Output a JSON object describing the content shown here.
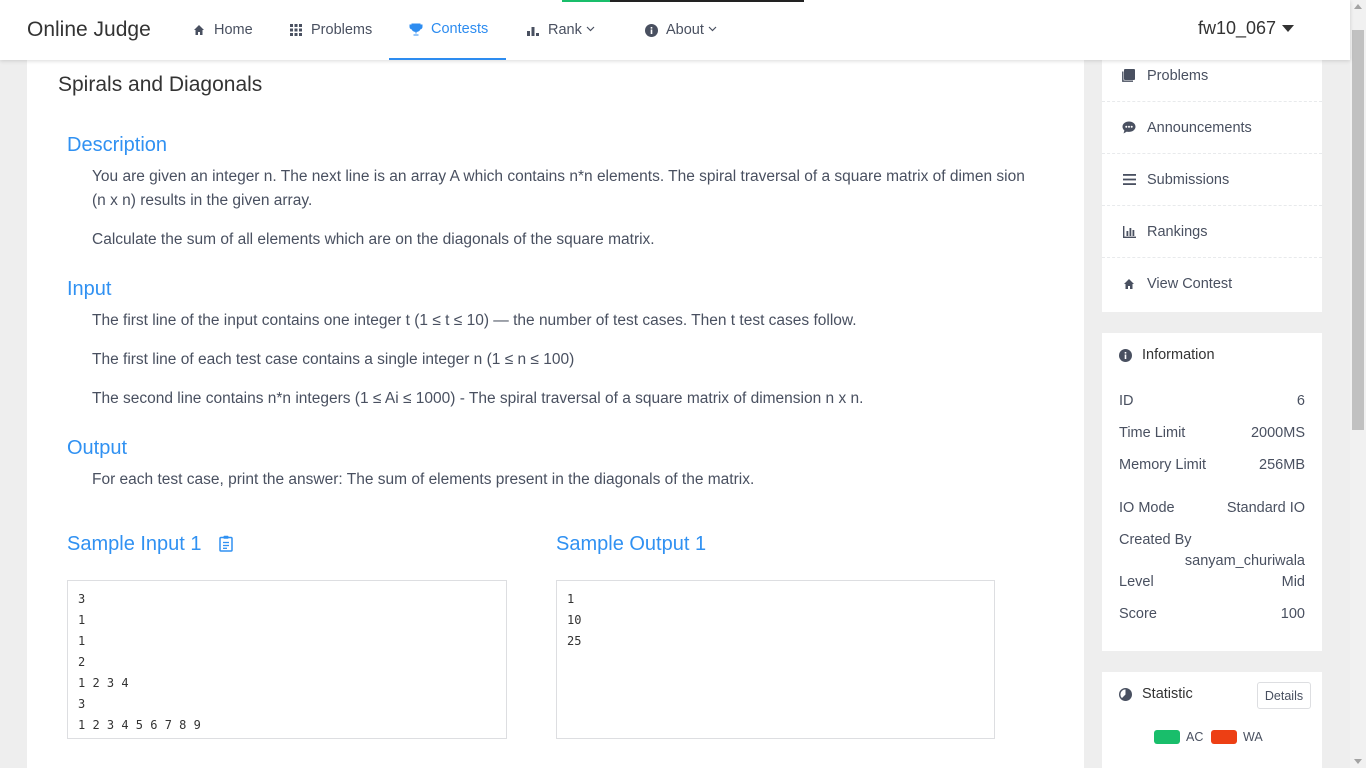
{
  "navbar": {
    "logo": "Online Judge",
    "items": [
      {
        "label": "Home",
        "icon": "home-icon"
      },
      {
        "label": "Problems",
        "icon": "grid-icon"
      },
      {
        "label": "Contests",
        "icon": "trophy-icon",
        "active": true
      },
      {
        "label": "Rank",
        "icon": "bar-chart-icon",
        "dropdown": true
      },
      {
        "label": "About",
        "icon": "info-icon",
        "dropdown": true
      }
    ],
    "user": "fw10_067"
  },
  "problem": {
    "title": "Spirals and Diagonals",
    "description_heading": "Description",
    "description": [
      "You are given an integer n. The next line is an array A which contains n*n elements. The spiral traversal of a square matrix of dimen sion (n x n) results in the given array.",
      "Calculate the sum of all elements which are on the diagonals of the square matrix."
    ],
    "input_heading": "Input",
    "input": [
      "The first line of the input contains one integer t (1 ≤ t ≤ 10) — the number of test cases. Then t test cases follow.",
      "The first line of each test case contains a single integer n (1 ≤ n ≤ 100)",
      "The second line contains n*n integers (1 ≤ Ai ≤ 1000) - The spiral traversal of a square matrix of dimension n x n."
    ],
    "output_heading": "Output",
    "output": [
      "For each test case, print the answer: The sum of elements present in the diagonals of the matrix."
    ],
    "sample_input_heading": "Sample Input 1",
    "sample_output_heading": "Sample Output 1",
    "sample_input": [
      "3",
      "1",
      "1",
      "2",
      "1 2 3 4",
      "3",
      "1 2 3 4 5 6 7 8 9"
    ],
    "sample_output": [
      "1",
      "10",
      "25"
    ]
  },
  "sidebar": {
    "menu": [
      {
        "label": "Problems",
        "icon": "book-icon"
      },
      {
        "label": "Announcements",
        "icon": "chat-icon"
      },
      {
        "label": "Submissions",
        "icon": "list-icon"
      },
      {
        "label": "Rankings",
        "icon": "bar-chart-icon"
      },
      {
        "label": "View Contest",
        "icon": "home-icon"
      }
    ],
    "info": {
      "heading": "Information",
      "rows": [
        {
          "key": "ID",
          "value": "6"
        },
        {
          "key": "Time Limit",
          "value": "2000MS"
        },
        {
          "key": "Memory Limit",
          "value": "256MB"
        },
        {
          "key": "IO Mode",
          "value": "Standard IO"
        },
        {
          "key": "Created By",
          "value": "sanyam_churiwala"
        },
        {
          "key": "Level",
          "value": "Mid"
        },
        {
          "key": "Score",
          "value": "100"
        }
      ]
    },
    "statistic": {
      "heading": "Statistic",
      "details_label": "Details",
      "legend": [
        {
          "label": "AC",
          "color": "#19be6b"
        },
        {
          "label": "WA",
          "color": "#ed3f14"
        }
      ]
    }
  },
  "colors": {
    "accent": "#2d8cf0",
    "heading": "#3091f2"
  }
}
